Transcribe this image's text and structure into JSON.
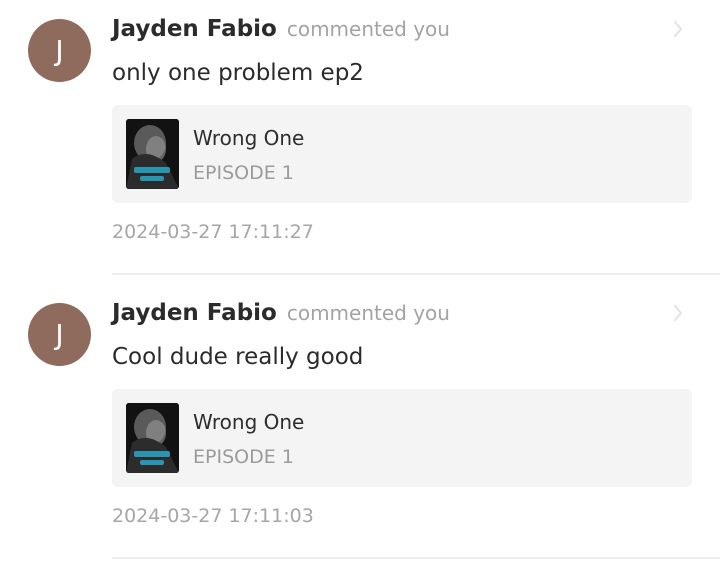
{
  "comments": [
    {
      "avatar_letter": "J",
      "username": "Jayden Fabio",
      "action": "commented you",
      "text": "only one problem ep2",
      "series_title": "Wrong One",
      "episode": "EPISODE 1",
      "timestamp": "2024-03-27 17:11:27"
    },
    {
      "avatar_letter": "J",
      "username": "Jayden Fabio",
      "action": "commented you",
      "text": "Cool dude really good",
      "series_title": "Wrong One",
      "episode": "EPISODE 1",
      "timestamp": "2024-03-27 17:11:03"
    }
  ],
  "colors": {
    "avatar_bg": "#8f6b5e",
    "card_bg": "#f4f4f4",
    "muted_text": "#a3a3a3",
    "primary_text": "#2b2b2b"
  },
  "icons": {
    "chevron": "chevron-right-icon",
    "cover": "cover-thumbnail"
  }
}
